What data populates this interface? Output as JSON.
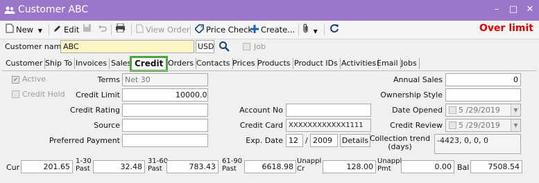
{
  "window": {
    "title": "Customer ABC",
    "minimize": "–",
    "maximize": "□",
    "close": "✕",
    "title_icon": "users-icon"
  },
  "toolbar": {
    "new_label": "New",
    "edit_label": "Edit",
    "view_order_label": "View Order",
    "price_check_label": "Price Check",
    "create_label": "Create...",
    "save_icon": "save-icon",
    "undo_icon": "undo-icon",
    "print_icon": "printer-icon",
    "attach_icon": "paperclip-icon",
    "refresh_icon": "refresh-icon"
  },
  "status": {
    "over_limit": "Over limit",
    "color": "#e00000"
  },
  "header": {
    "customer_name_label": "Customer name",
    "customer_name_value": "ABC",
    "currency": "USD",
    "job_label": "Job"
  },
  "tabs": [
    {
      "label": "Customer"
    },
    {
      "label": "Ship To"
    },
    {
      "label": "Invoices"
    },
    {
      "label": "Sales"
    },
    {
      "label": "Credit"
    },
    {
      "label": "Orders"
    },
    {
      "label": "Contacts"
    },
    {
      "label": "Prices"
    },
    {
      "label": "Products"
    },
    {
      "label": "Product IDs"
    },
    {
      "label": "Activities"
    },
    {
      "label": "Email"
    },
    {
      "label": "Jobs"
    }
  ],
  "active_tab": "Credit",
  "credit": {
    "active_label": "Active",
    "active_checked": true,
    "credit_hold_label": "Credit Hold",
    "credit_hold_checked": false,
    "terms_label": "Terms",
    "terms_value": "Net 30",
    "credit_limit_label": "Credit Limit",
    "credit_limit_value": "10000.00",
    "credit_rating_label": "Credit Rating",
    "credit_rating_value": "",
    "source_label": "Source",
    "source_value": "",
    "preferred_payment_label": "Preferred Payment",
    "preferred_payment_value": "",
    "account_no_label": "Account No",
    "account_no_value": "",
    "credit_card_label": "Credit Card",
    "credit_card_value": "XXXXXXXXXXXX1111",
    "exp_date_label": "Exp. Date",
    "exp_month": "12",
    "exp_sep": "/",
    "exp_year": "2009",
    "details_label": "Details",
    "annual_sales_label": "Annual Sales",
    "annual_sales_value": "0",
    "ownership_style_label": "Ownership Style",
    "ownership_style_value": "",
    "date_opened_label": "Date Opened",
    "date_opened_value": "5 /29/2019",
    "credit_review_label": "Credit Review",
    "credit_review_value": "5 /29/2019",
    "collection_trend_label": "Collection trend\n(days)",
    "collection_trend_value": "-4423, 0, 0, 0"
  },
  "aging": {
    "cur_label": "Cur",
    "cur_value": "201.65",
    "p1_30_label": "1-30\nPast",
    "p1_30_value": "32.48",
    "p31_60_label": "31-60\nPast",
    "p31_60_value": "783.43",
    "p61_90_label": "61-90\nPast",
    "p61_90_value": "6618.98",
    "unappl_cr_label": "Unappl\nCr",
    "unappl_cr_value": "128.00",
    "unappl_pmt_label": "Unappl\nPmt",
    "unappl_pmt_value": "0.00",
    "bal_label": "Bal",
    "bal_value": "7508.54"
  }
}
